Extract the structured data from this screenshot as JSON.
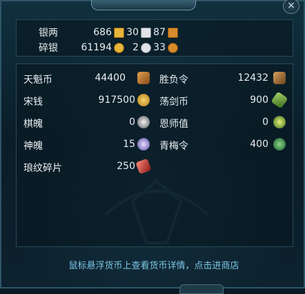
{
  "silver": {
    "row1_label": "银两",
    "row1_gold": "686",
    "row1_silver": "30",
    "row1_copper": "87",
    "row2_label": "碎银",
    "row2_gold": "61194",
    "row2_silver": "2",
    "row2_copper": "33"
  },
  "currencies": [
    {
      "label": "天魁币",
      "value": "44400",
      "icon": "tianxkui-coin-icon",
      "color": "#c8863a"
    },
    {
      "label": "胜负令",
      "value": "12432",
      "icon": "token-icon",
      "color": "#a87a3a"
    },
    {
      "label": "宋钱",
      "value": "917500",
      "icon": "song-coin-icon",
      "color": "#e2b43c"
    },
    {
      "label": "荡剑币",
      "value": "900",
      "icon": "sword-coin-icon",
      "color": "#7ab04a"
    },
    {
      "label": "棋魄",
      "value": "0",
      "icon": "chess-soul-icon",
      "color": "#c7c9cc"
    },
    {
      "label": "恩师值",
      "value": "0",
      "icon": "mentor-icon",
      "color": "#8fbf3a"
    },
    {
      "label": "神魄",
      "value": "15",
      "icon": "divine-soul-icon",
      "color": "#8a7ad8"
    },
    {
      "label": "青梅令",
      "value": "400",
      "icon": "plum-token-icon",
      "color": "#3a9a5a"
    },
    {
      "label": "琅纹碎片",
      "value": "250",
      "icon": "fragment-icon",
      "color": "#c43a3a"
    }
  ],
  "hint": "鼠标悬浮货币上查看货币详情，点击进商店",
  "close_label": "×"
}
